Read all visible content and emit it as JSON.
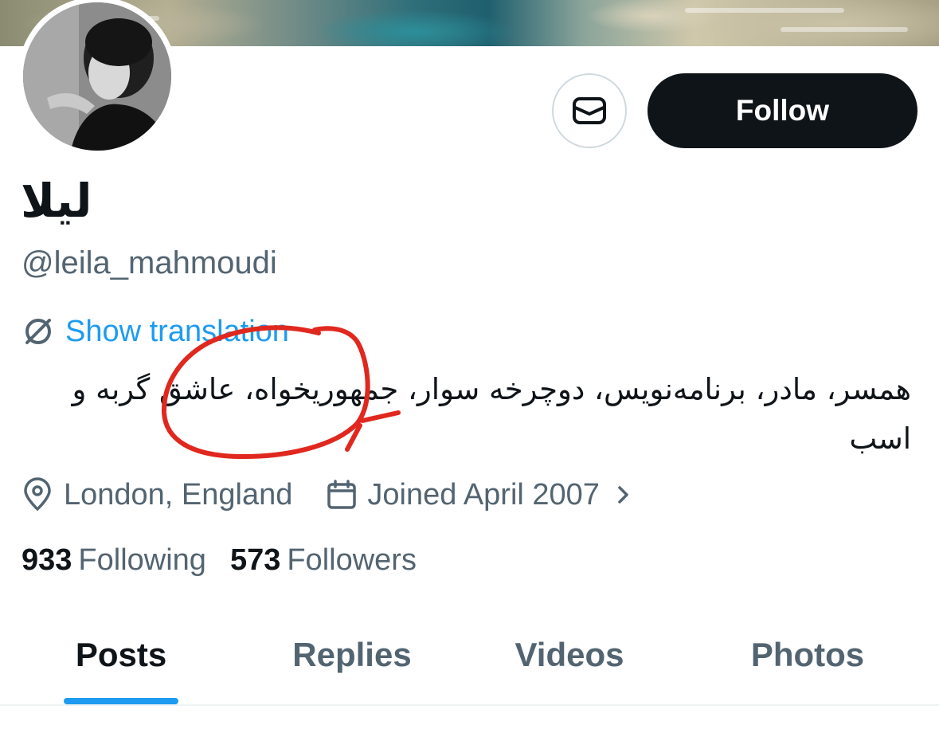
{
  "profile": {
    "display_name": "ليلا",
    "handle": "@leila_mahmoudi",
    "translate_label": "Show translation",
    "bio": "همسر، مادر، برنامه‌نویس، دوچرخه سوار، جمهوریخواه، عاشق گربه و اسب",
    "location": "London, England",
    "joined": "Joined April 2007",
    "following_count": "933",
    "following_label": "Following",
    "followers_count": "573",
    "followers_label": "Followers"
  },
  "actions": {
    "message_icon": "envelope-icon",
    "follow_label": "Follow"
  },
  "tabs": [
    {
      "label": "Posts",
      "active": true
    },
    {
      "label": "Replies",
      "active": false
    },
    {
      "label": "Videos",
      "active": false
    },
    {
      "label": "Photos",
      "active": false
    }
  ],
  "colors": {
    "accent": "#1d9bf0",
    "text_primary": "#0f1419",
    "text_secondary": "#536471",
    "annotation": "#e0281e"
  }
}
